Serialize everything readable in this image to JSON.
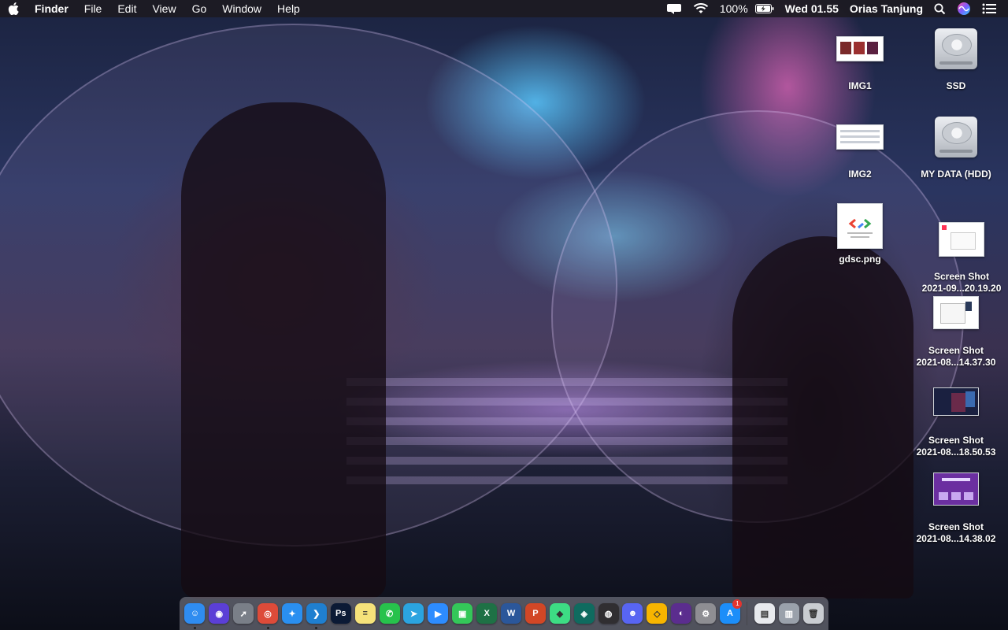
{
  "menubar": {
    "app_name": "Finder",
    "menus": [
      "File",
      "Edit",
      "View",
      "Go",
      "Window",
      "Help"
    ],
    "battery": "100%",
    "clock": "Wed 01.55",
    "user": "Orias Tanjung"
  },
  "desktop": {
    "icons": [
      {
        "label": "IMG1",
        "icon": "image-thumbnail"
      },
      {
        "label": "SSD",
        "icon": "internal-drive-icon"
      },
      {
        "label": "IMG2",
        "icon": "image-thumbnail"
      },
      {
        "label": "MY DATA (HDD)",
        "icon": "internal-drive-icon"
      },
      {
        "label": "gdsc.png",
        "icon": "image-thumbnail"
      },
      {
        "label_line1": "Screen Shot",
        "label_line2": "2021-09...20.19.20",
        "icon": "screenshot-thumbnail"
      },
      {
        "label_line1": "Screen Shot",
        "label_line2": "2021-08...14.37.30",
        "icon": "screenshot-thumbnail"
      },
      {
        "label_line1": "Screen Shot",
        "label_line2": "2021-08...18.50.53",
        "icon": "screenshot-thumbnail"
      },
      {
        "label_line1": "Screen Shot",
        "label_line2": "2021-08...14.38.02",
        "icon": "screenshot-thumbnail"
      }
    ]
  },
  "dock": {
    "apps": [
      {
        "name": "Finder",
        "glyph": "☺",
        "bg": "#2f8cf0",
        "running": true
      },
      {
        "name": "Siri",
        "glyph": "◉",
        "bg": "#5b3fd6",
        "running": false
      },
      {
        "name": "Launchpad",
        "glyph": "➚",
        "bg": "#7a7f88",
        "running": false
      },
      {
        "name": "Chrome",
        "glyph": "◎",
        "bg": "#dd4b39",
        "running": true
      },
      {
        "name": "Safari",
        "glyph": "✦",
        "bg": "#2a8ff0",
        "running": false
      },
      {
        "name": "VS Code",
        "glyph": "❯",
        "bg": "#1f7fd0",
        "running": true
      },
      {
        "name": "Photoshop",
        "glyph": "Ps",
        "bg": "#0b1a35",
        "running": false
      },
      {
        "name": "Notes",
        "glyph": "≡",
        "bg": "#f5e27a",
        "running": false
      },
      {
        "name": "WhatsApp",
        "glyph": "✆",
        "bg": "#27c24c",
        "running": false
      },
      {
        "name": "Telegram",
        "glyph": "➤",
        "bg": "#2ba4e0",
        "running": false
      },
      {
        "name": "Zoom",
        "glyph": "▶",
        "bg": "#2d8cff",
        "running": false
      },
      {
        "name": "FaceTime",
        "glyph": "▣",
        "bg": "#34c759",
        "running": false
      },
      {
        "name": "Excel",
        "glyph": "X",
        "bg": "#1e7145",
        "running": false
      },
      {
        "name": "Word",
        "glyph": "W",
        "bg": "#2b579a",
        "running": false
      },
      {
        "name": "PowerPoint",
        "glyph": "P",
        "bg": "#d24726",
        "running": false
      },
      {
        "name": "Android Studio",
        "glyph": "◆",
        "bg": "#3ddc84",
        "running": false
      },
      {
        "name": "Sourcetree",
        "glyph": "◈",
        "bg": "#0f6b5f",
        "running": false
      },
      {
        "name": "OBS",
        "glyph": "◍",
        "bg": "#302e31",
        "running": false
      },
      {
        "name": "Discord",
        "glyph": "☻",
        "bg": "#5865f2",
        "running": false
      },
      {
        "name": "Sketch",
        "glyph": "◇",
        "bg": "#f7b500",
        "running": false
      },
      {
        "name": "GitHub Desktop",
        "glyph": "◐",
        "bg": "#5b2d8e",
        "running": false
      },
      {
        "name": "System Preferences",
        "glyph": "⚙",
        "bg": "#8e8e93",
        "running": false
      },
      {
        "name": "App Store",
        "glyph": "A",
        "bg": "#1c8ef9",
        "running": false,
        "badge": "1"
      }
    ],
    "trailing": [
      {
        "name": "Documents",
        "glyph": "▤",
        "bg": "#e8eaee"
      },
      {
        "name": "Downloads",
        "glyph": "▥",
        "bg": "#9aa1ab"
      },
      {
        "name": "Trash",
        "glyph": "🗑",
        "bg": "#c9ccd1"
      }
    ]
  }
}
